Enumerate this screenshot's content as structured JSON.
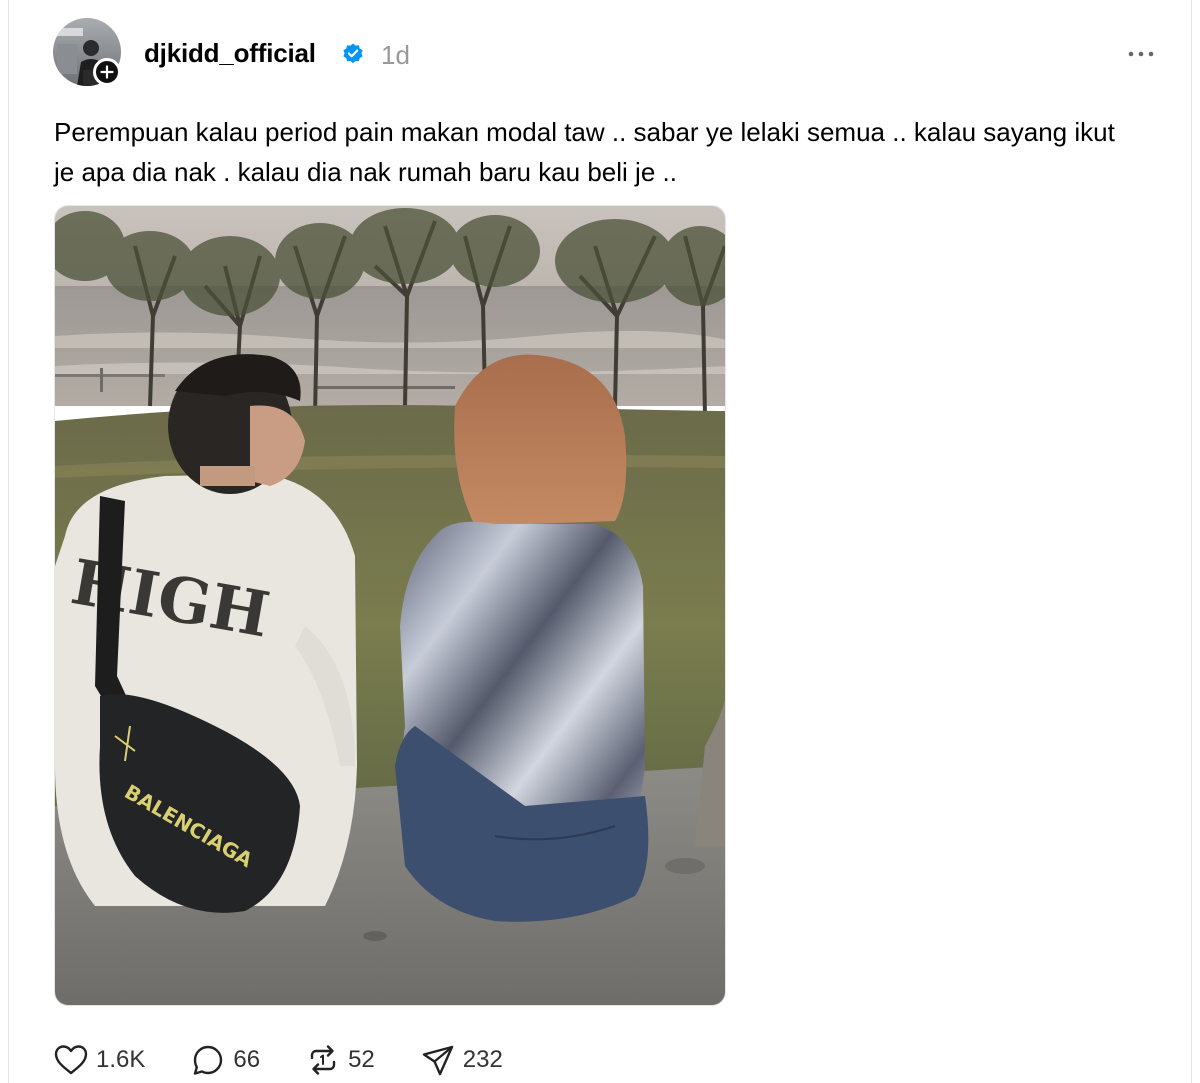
{
  "post": {
    "username": "djkidd_official",
    "time": "1d",
    "text": "Perempuan kalau period pain makan modal taw .. sabar ye lelaki semua .. kalau sayang ikut je apa dia nak . kalau dia nak rumah baru kau beli je ..",
    "photo_shirt_text": "HIGH",
    "photo_bag_text": "BALENCIAGA",
    "verified_color": "#0095f6"
  },
  "actions": {
    "likes": "1.6K",
    "comments": "66",
    "reposts": "52",
    "shares": "232"
  },
  "icons": {
    "follow": "plus-icon",
    "verified": "verified-badge-icon",
    "more": "ellipsis-icon",
    "like": "heart-icon",
    "comment": "comment-bubble-icon",
    "repost": "repost-icon",
    "share": "send-icon"
  }
}
